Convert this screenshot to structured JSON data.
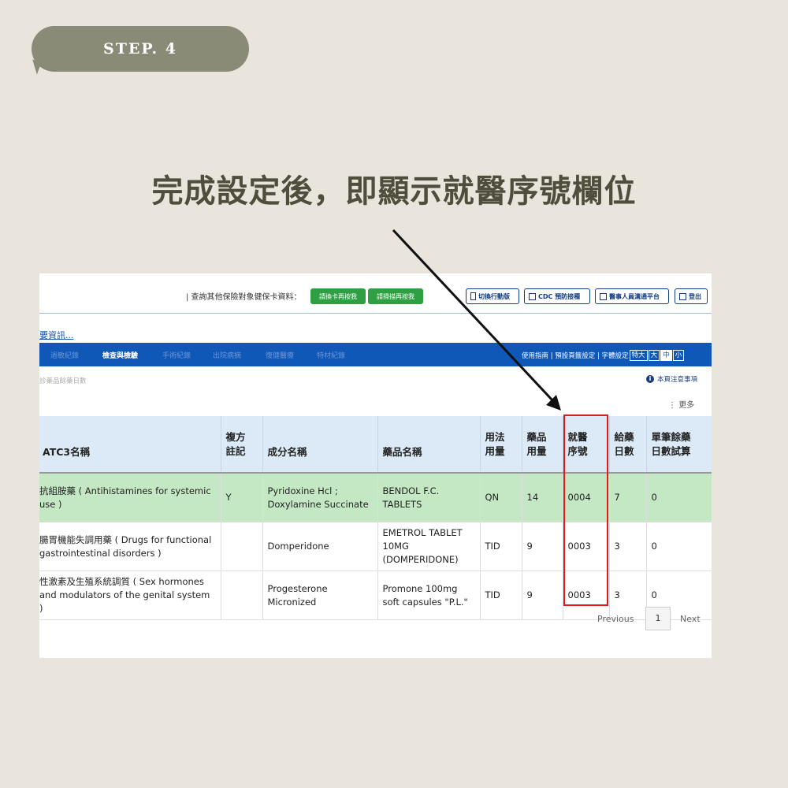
{
  "step": {
    "label": "STEP. 4"
  },
  "headline": "完成設定後，即顯示就醫序號欄位",
  "topbar": {
    "query_text": "|  查詢其他保險對象健保卡資料：",
    "btn_reinsert": "請換卡再按我",
    "btn_scan": "請掃描再按我",
    "btn_mobile": "切換行動版",
    "btn_cdc": "CDC 預防接種",
    "btn_medical": "醫事人員溝通平台",
    "btn_logout": "登出"
  },
  "more_link": "要資訊...",
  "nav": {
    "items": [
      "過敏紀錄",
      "檢查與檢驗",
      "手術紀錄",
      "出院病摘",
      "復健醫療",
      "特材紀錄"
    ],
    "active_index": 1,
    "right_text": "使用指南 | 預設頁籤設定 | 字體設定",
    "sizes": [
      "特大",
      "大",
      "中",
      "小"
    ],
    "active_size_index": 2
  },
  "sub_text": "診藥品餘藥日數",
  "notice": "本頁注意事項",
  "more_menu": "更多",
  "table": {
    "headers": [
      {
        "line1": "ATC3名稱",
        "line2": ""
      },
      {
        "line1": "複方",
        "line2": "註記"
      },
      {
        "line1": "成分名稱",
        "line2": ""
      },
      {
        "line1": "藥品名稱",
        "line2": ""
      },
      {
        "line1": "用法",
        "line2": "用量"
      },
      {
        "line1": "藥品",
        "line2": "用量"
      },
      {
        "line1": "就醫",
        "line2": "序號"
      },
      {
        "line1": "給藥",
        "line2": "日數"
      },
      {
        "line1": "單筆餘藥",
        "line2": "日數試算"
      }
    ],
    "rows": [
      {
        "atc3": "抗組胺藥 ( Antihistamines for systemic use )",
        "compound": "Y",
        "ingredient": "Pyridoxine Hcl ; Doxylamine Succinate",
        "drug_name": "BENDOL F.C. TABLETS",
        "usage": "QN",
        "qty": "14",
        "visit_no": "0004",
        "days": "7",
        "remaining": "0"
      },
      {
        "atc3": "腸胃機能失調用藥 ( Drugs for functional gastrointestinal disorders )",
        "compound": "",
        "ingredient": "Domperidone",
        "drug_name": "EMETROL TABLET 10MG (DOMPERIDONE)",
        "usage": "TID",
        "qty": "9",
        "visit_no": "0003",
        "days": "3",
        "remaining": "0"
      },
      {
        "atc3": "性激素及生殖系統調質 ( Sex hormones and modulators of the genital system )",
        "compound": "",
        "ingredient": "Progesterone Micronized",
        "drug_name": "Promone 100mg soft capsules \"P.L.\"",
        "usage": "TID",
        "qty": "9",
        "visit_no": "0003",
        "days": "3",
        "remaining": "0"
      }
    ]
  },
  "pager": {
    "previous": "Previous",
    "page": "1",
    "next": "Next"
  },
  "colors": {
    "background": "#e9e4dc",
    "pill": "#8a8b77",
    "nav": "#0f58b8",
    "highlight_row": "#c3e8c3",
    "red_box": "#e11919"
  }
}
